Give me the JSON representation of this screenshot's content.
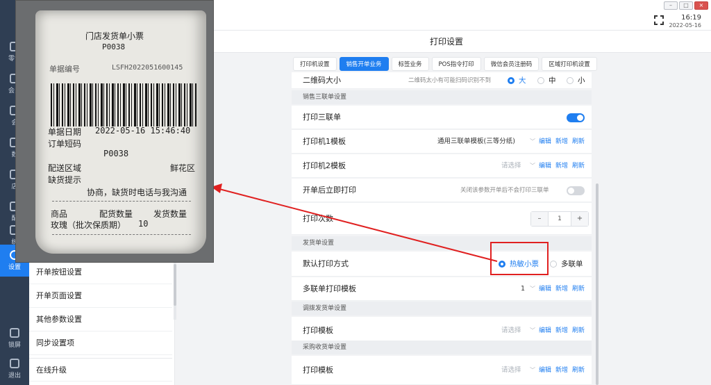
{
  "rail": {
    "items": [
      {
        "label": "零售"
      },
      {
        "label": "会员"
      },
      {
        "label": "会"
      },
      {
        "label": "数"
      },
      {
        "label": "店"
      },
      {
        "label": "配"
      },
      {
        "label": "统"
      },
      {
        "label": "设置"
      },
      {
        "label": "锁屏"
      },
      {
        "label": "退出"
      }
    ]
  },
  "titlebar": {
    "time": "16:19",
    "date": "2022-05-16",
    "min": "–",
    "max": "□",
    "close": "×"
  },
  "menu": {
    "items": [
      {
        "label": "开单按钮设置"
      },
      {
        "label": "开单页面设置"
      },
      {
        "label": "其他参数设置"
      },
      {
        "label": "同步设置项"
      },
      {
        "label": "在线升级"
      }
    ]
  },
  "main": {
    "title": "打印设置",
    "tabs": [
      {
        "label": "打印机设置",
        "active": false
      },
      {
        "label": "销售开单业务",
        "active": true
      },
      {
        "label": "标签业务",
        "active": false
      },
      {
        "label": "POS指令打印",
        "active": false
      },
      {
        "label": "微信会员注册码",
        "active": false
      },
      {
        "label": "区域打印机设置",
        "active": false
      }
    ],
    "qr": {
      "label": "二维码大小",
      "hint": "二维码太小有可能扫码识别不到",
      "options": [
        "大",
        "中",
        "小"
      ],
      "selected": "大"
    },
    "section_triple": "销售三联单设置",
    "print_triple": {
      "label": "打印三联单",
      "on": true
    },
    "printer1": {
      "label": "打印机1模板",
      "value": "通用三联单模板(三等分纸)"
    },
    "printer2": {
      "label": "打印机2模板",
      "placeholder": "请选择"
    },
    "link_edit": "编辑",
    "link_add": "新增",
    "link_refresh": "刷新",
    "auto_print": {
      "label": "开单后立即打印",
      "hint": "关闭该参数开单后不会打印三联单",
      "on": false
    },
    "print_count": {
      "label": "打印次数",
      "value": "1",
      "minus": "–",
      "plus": "+"
    },
    "section_ship": "发货单设置",
    "default_mode": {
      "label": "默认打印方式",
      "options": [
        "热敏小票",
        "多联单"
      ],
      "selected": "热敏小票"
    },
    "multi_tpl": {
      "label": "多联单打印模板",
      "value": "1"
    },
    "section_transfer": "调拨发货单设置",
    "transfer_tpl": {
      "label": "打印模板",
      "placeholder": "请选择"
    },
    "section_purchase": "采购收货单设置",
    "purchase_tpl": {
      "label": "打印模板",
      "placeholder": "请选择"
    }
  },
  "receipt": {
    "title": "门店发货单小票",
    "code_top": "P0038",
    "doc_no_label": "单据编号",
    "doc_no": "LSFH2022051600145",
    "date_label": "单据日期",
    "date": "2022-05-16 15:46:40",
    "short_label": "订单短码",
    "short_code": "P0038",
    "area_label": "配送区域",
    "area": "鲜花区",
    "shortage_label": "缺货提示",
    "shortage": "协商，缺货时电话与我沟通",
    "col_goods": "商品",
    "col_qty": "配货数量",
    "col_ship": "发货数量",
    "item_name": "玫瑰（批次保质期）",
    "item_qty": "10"
  },
  "colors": {
    "accent": "#1f7ef0",
    "annotation": "#e02020"
  }
}
